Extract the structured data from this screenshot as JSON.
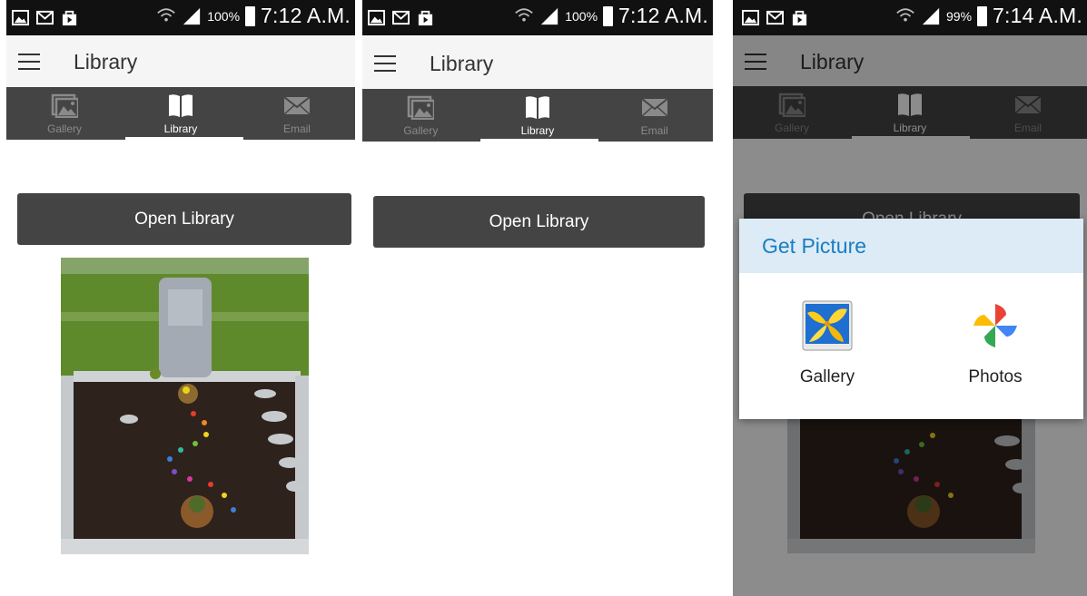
{
  "screens": [
    {
      "status": {
        "battery": "100%",
        "time": "7:12 A.M."
      },
      "appbar": {
        "title": "Library"
      },
      "tabs": [
        {
          "label": "Gallery",
          "icon": "gallery-icon"
        },
        {
          "label": "Library",
          "icon": "book-icon",
          "active": true
        },
        {
          "label": "Email",
          "icon": "email-icon"
        }
      ],
      "open_button": "Open Library",
      "has_photo": true
    },
    {
      "status": {
        "battery": "100%",
        "time": "7:12 A.M."
      },
      "appbar": {
        "title": "Library"
      },
      "tabs": [
        {
          "label": "Gallery",
          "icon": "gallery-icon"
        },
        {
          "label": "Library",
          "icon": "book-icon",
          "active": true
        },
        {
          "label": "Email",
          "icon": "email-icon"
        }
      ],
      "open_button": "Open Library",
      "has_photo": false
    },
    {
      "status": {
        "battery": "99%",
        "time": "7:14 A.M."
      },
      "appbar": {
        "title": "Library"
      },
      "tabs": [
        {
          "label": "Gallery",
          "icon": "gallery-icon"
        },
        {
          "label": "Library",
          "icon": "book-icon",
          "active": true
        },
        {
          "label": "Email",
          "icon": "email-icon"
        }
      ],
      "open_button": "Open Library",
      "has_photo": true,
      "dialog": {
        "title": "Get Picture",
        "options": [
          {
            "label": "Gallery",
            "icon": "gallery-app-icon"
          },
          {
            "label": "Photos",
            "icon": "photos-app-icon"
          }
        ]
      }
    }
  ],
  "colors": {
    "status_bar": "#111111",
    "app_bar": "#f5f5f5",
    "tab_bar": "#444444",
    "button": "#444444",
    "dialog_header": "#dcebf5",
    "dialog_title": "#1b7dc3"
  }
}
